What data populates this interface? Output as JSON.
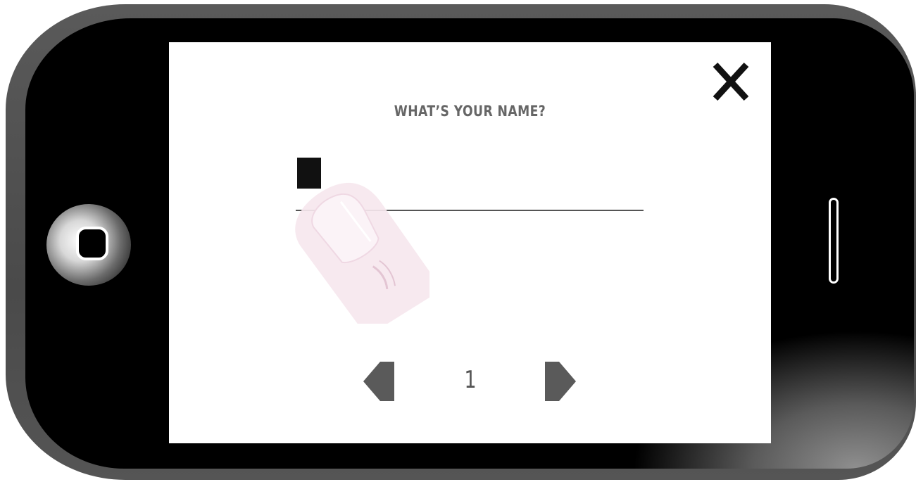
{
  "modal": {
    "title": "WHAT’S YOUR NAME?",
    "name_input_value": "",
    "close_icon": "close-x-icon"
  },
  "pager": {
    "current_page": "1",
    "prev_icon": "triangle-left-icon",
    "next_icon": "triangle-right-icon"
  },
  "device": {
    "home_icon": "home-button-icon",
    "overlay_icon": "tapping-finger-icon"
  },
  "colors": {
    "title_text": "#666666",
    "arrows": "#5a5a5a",
    "finger": "#f4e6ee",
    "phone_body": "#4a4a4a",
    "bezel": "#000000"
  }
}
